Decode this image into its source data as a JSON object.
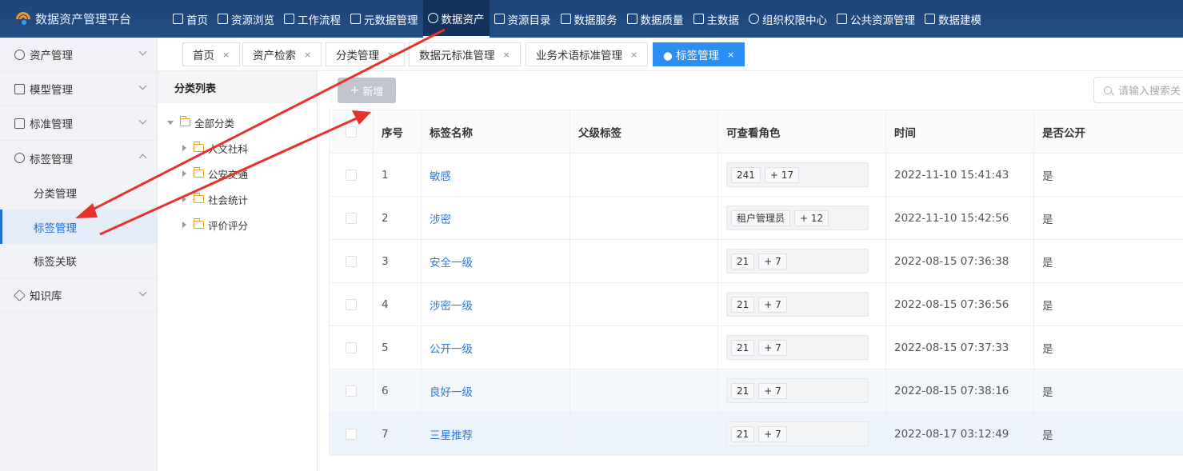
{
  "app": {
    "title": "数据资产管理平台"
  },
  "topnav": [
    {
      "label": "首页"
    },
    {
      "label": "资源浏览"
    },
    {
      "label": "工作流程"
    },
    {
      "label": "元数据管理"
    },
    {
      "label": "数据资产"
    },
    {
      "label": "资源目录"
    },
    {
      "label": "数据服务"
    },
    {
      "label": "数据质量"
    },
    {
      "label": "主数据"
    },
    {
      "label": "组织权限中心"
    },
    {
      "label": "公共资源管理"
    },
    {
      "label": "数据建模"
    }
  ],
  "sidebar": {
    "groups": [
      {
        "label": "资产管理"
      },
      {
        "label": "模型管理"
      },
      {
        "label": "标准管理"
      },
      {
        "label": "标签管理"
      },
      {
        "label": "知识库"
      }
    ],
    "sub": [
      {
        "label": "分类管理"
      },
      {
        "label": "标签管理"
      },
      {
        "label": "标签关联"
      }
    ]
  },
  "tabs": [
    {
      "label": "首页",
      "close": "×"
    },
    {
      "label": "资产检索",
      "close": "×"
    },
    {
      "label": "分类管理",
      "close": "×"
    },
    {
      "label": "数据元标准管理",
      "close": "×"
    },
    {
      "label": "业务术语标准管理",
      "close": "×"
    },
    {
      "label": "● 标签管理",
      "close": "×"
    }
  ],
  "tree": {
    "title": "分类列表",
    "root": "全部分类",
    "children": [
      "人文社科",
      "公安交通",
      "社会统计",
      "评价评分"
    ]
  },
  "toolbar": {
    "add_label": "新增",
    "add_icon": "+",
    "search_placeholder": "请输入搜索关"
  },
  "table": {
    "columns": [
      "序号",
      "标签名称",
      "父级标签",
      "可查看角色",
      "时间",
      "是否公开"
    ],
    "rows": [
      {
        "no": "1",
        "name": "敏感",
        "parent": "",
        "role": "241",
        "more": "+ 17",
        "time": "2022-11-10 15:41:43",
        "public": "是"
      },
      {
        "no": "2",
        "name": "涉密",
        "parent": "",
        "role": "租户管理员",
        "more": "+ 12",
        "time": "2022-11-10 15:42:56",
        "public": "是"
      },
      {
        "no": "3",
        "name": "安全一级",
        "parent": "",
        "role": "21",
        "more": "+ 7",
        "time": "2022-08-15 07:36:38",
        "public": "是"
      },
      {
        "no": "4",
        "name": "涉密一级",
        "parent": "",
        "role": "21",
        "more": "+ 7",
        "time": "2022-08-15 07:36:56",
        "public": "是"
      },
      {
        "no": "5",
        "name": "公开一级",
        "parent": "",
        "role": "21",
        "more": "+ 7",
        "time": "2022-08-15 07:37:33",
        "public": "是"
      },
      {
        "no": "6",
        "name": "良好一级",
        "parent": "",
        "role": "21",
        "more": "+ 7",
        "time": "2022-08-15 07:38:16",
        "public": "是"
      },
      {
        "no": "7",
        "name": "三星推荐",
        "parent": "",
        "role": "21",
        "more": "+ 7",
        "time": "2022-08-17 03:12:49",
        "public": "是"
      }
    ]
  },
  "colors": {
    "nav_bg": "#1f4478",
    "accent": "#2c8df4",
    "link": "#2f79d4",
    "arrow": "#e8322b",
    "logo": "#f39a1e"
  }
}
